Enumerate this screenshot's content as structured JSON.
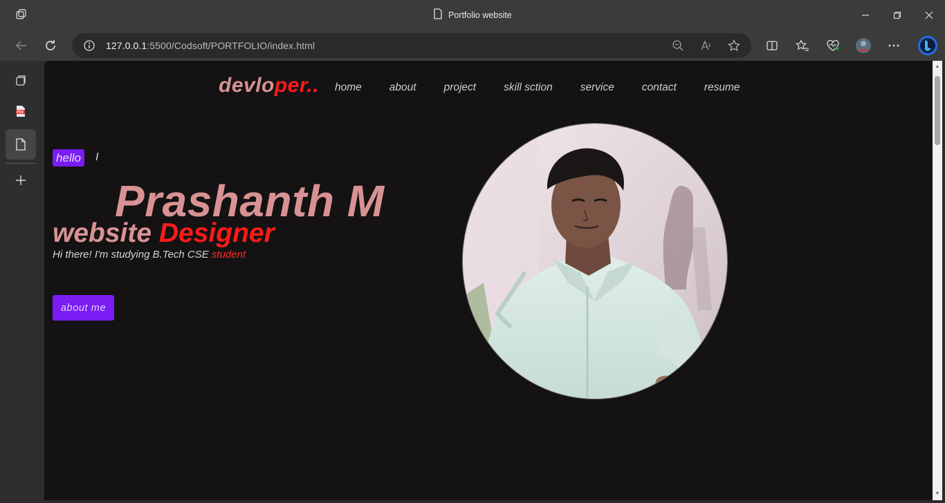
{
  "window": {
    "title": "Portfolio website"
  },
  "address_bar": {
    "host": "127.0.0.1",
    "path": ":5500/Codsoft/PORTFOLIO/index.html"
  },
  "site": {
    "logo": {
      "part1": "devlo",
      "part2": "per.."
    },
    "nav": [
      {
        "label": "home"
      },
      {
        "label": "about"
      },
      {
        "label": "project"
      },
      {
        "label": "skill sction"
      },
      {
        "label": "service"
      },
      {
        "label": "contact"
      },
      {
        "label": "resume"
      }
    ],
    "hero": {
      "hello": "hello",
      "cursor": "I",
      "name": "Prashanth M",
      "role_part1": "website ",
      "role_part2": "Designer",
      "tagline_part1": "Hi there! I'm studying B.Tech CSE ",
      "tagline_part2": "student",
      "button": "about me"
    }
  },
  "colors": {
    "accent_purple": "#7a1cf2",
    "accent_red": "#ff1a1a",
    "text_pink": "#d99294",
    "page_bg": "#141213"
  }
}
